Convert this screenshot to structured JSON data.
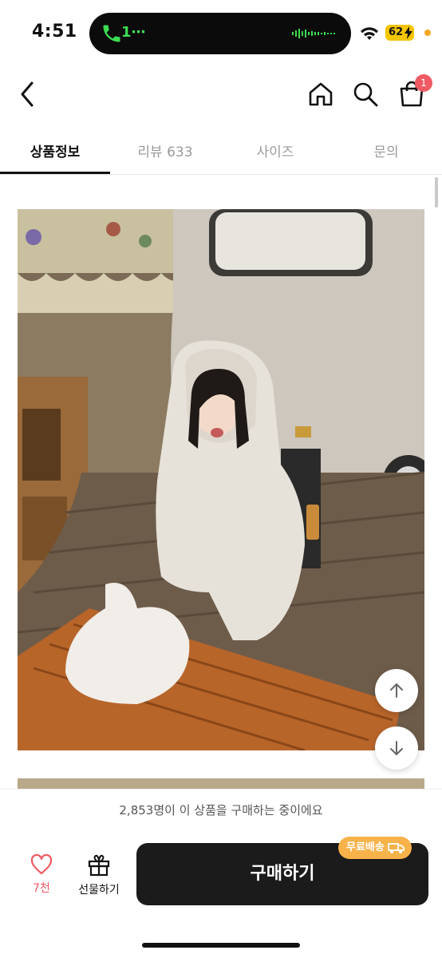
{
  "status": {
    "time": "4:51",
    "call": "1⋯",
    "battery": "62"
  },
  "header": {
    "cart_count": "1"
  },
  "tabs": [
    {
      "label": "상품정보"
    },
    {
      "label": "리뷰 633"
    },
    {
      "label": "사이즈"
    },
    {
      "label": "문의"
    }
  ],
  "notice": "2,853명이 이 상품을 구매하는 중이에요",
  "bottom": {
    "like_count": "7천",
    "gift_label": "선물하기",
    "buy_label": "구매하기",
    "shipping_badge": "무료배송"
  },
  "colors": {
    "accent": "#ef5a63",
    "buy_bg": "#1b1b1b",
    "shipping": "#f7b24a"
  }
}
